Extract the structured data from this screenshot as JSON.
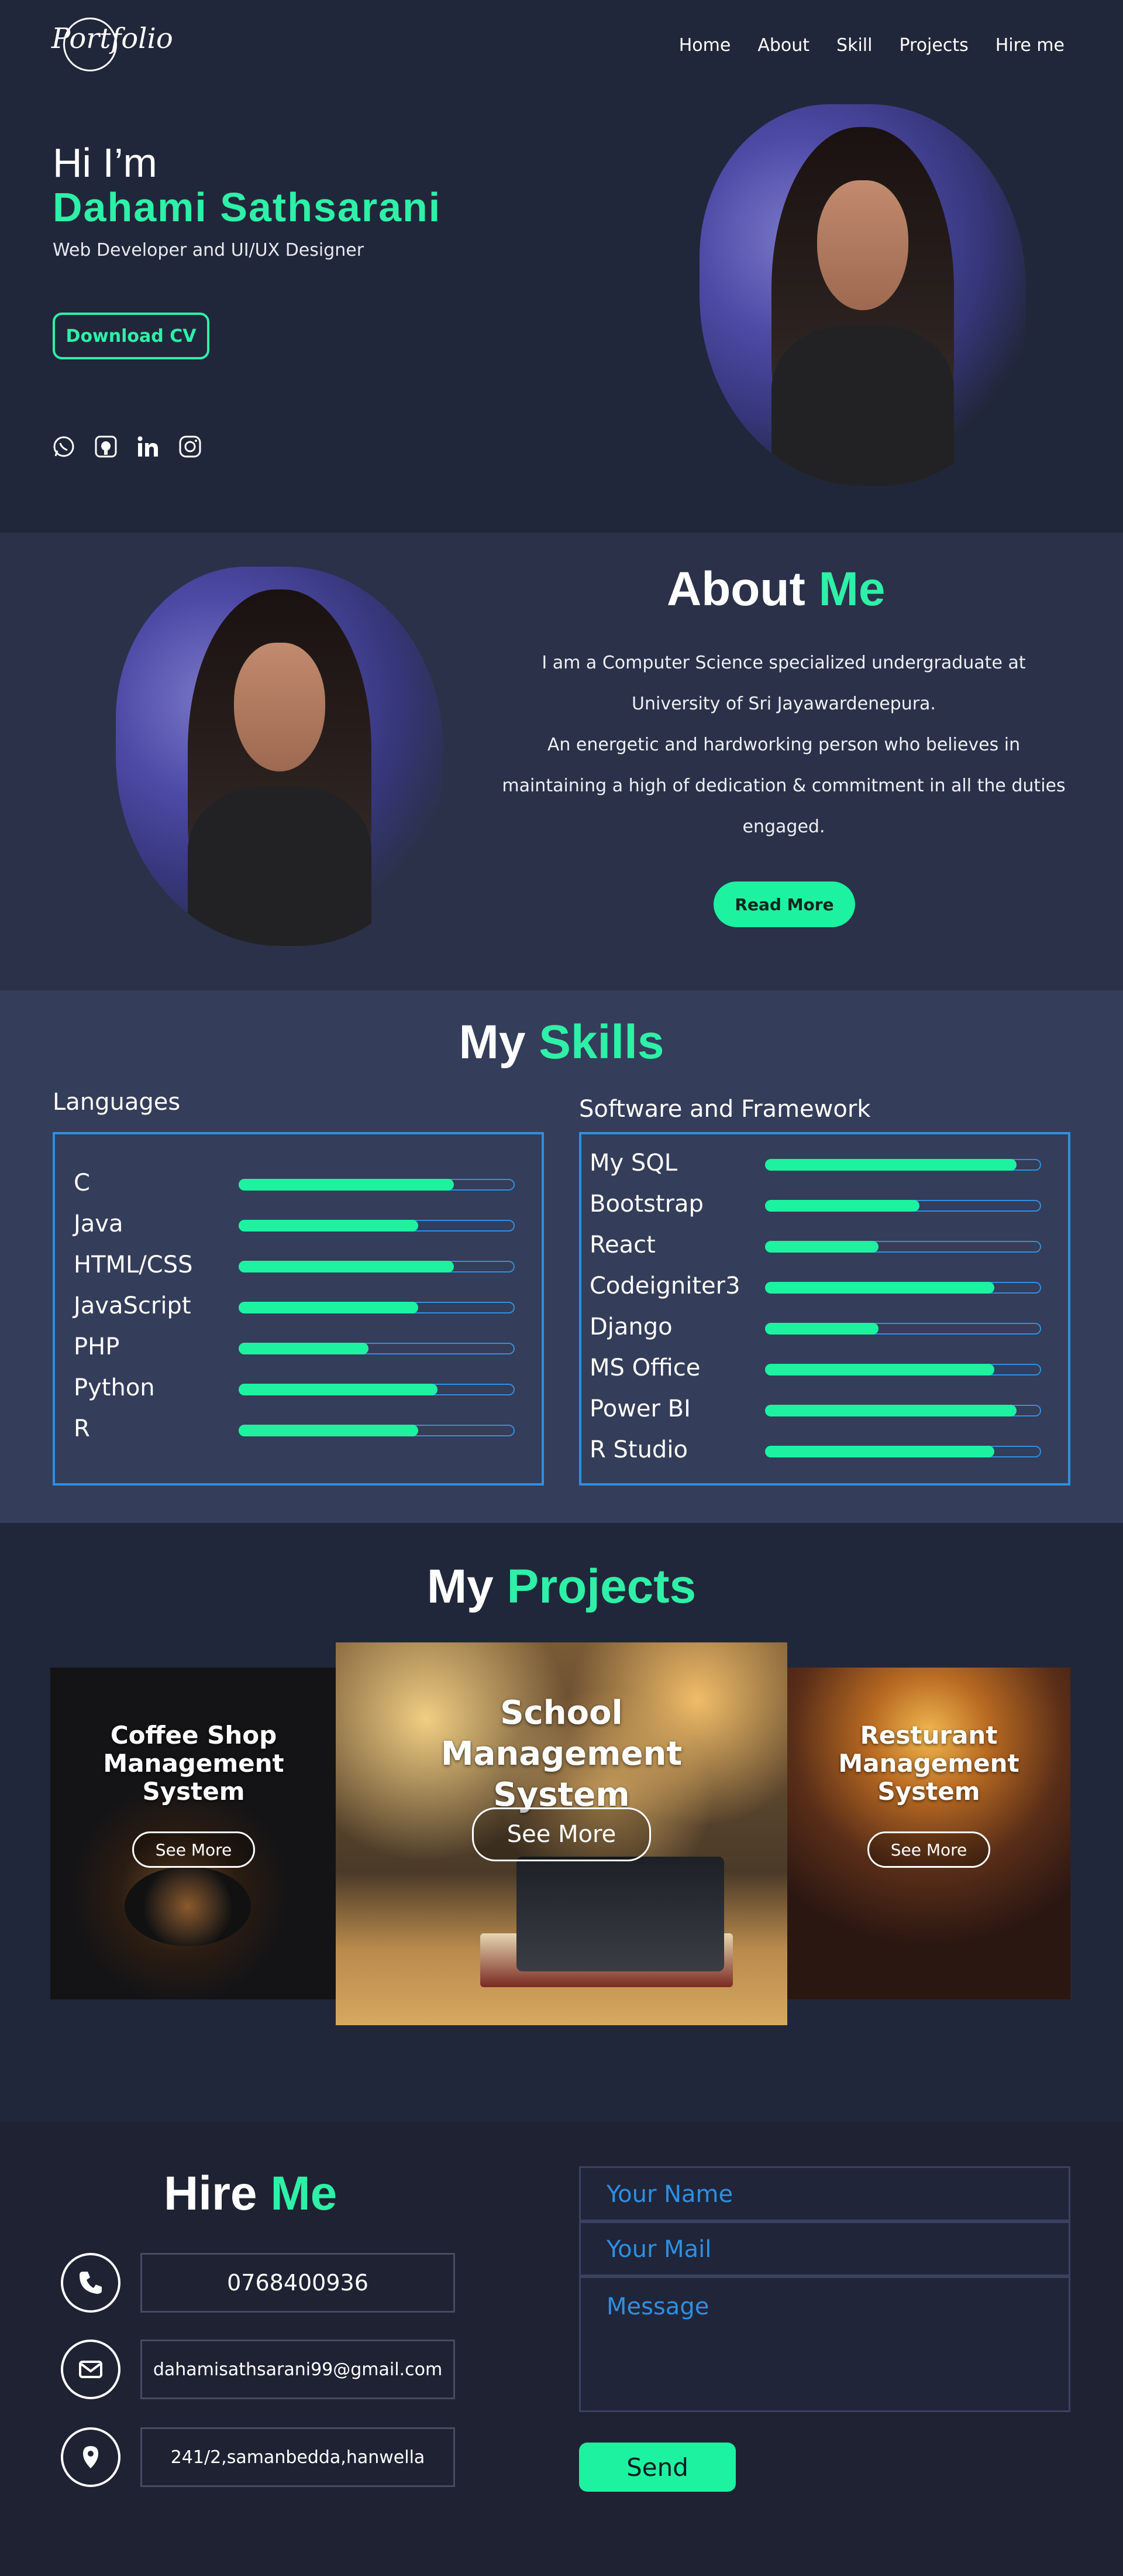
{
  "header": {
    "logo": "Portfolio",
    "nav": [
      "Home",
      "About",
      "Skill",
      "Projects",
      "Hire me"
    ]
  },
  "hero": {
    "greeting": "Hi I’m",
    "name": "Dahami Sathsarani",
    "role": "Web Developer and UI/UX Designer",
    "cv_button": "Download CV",
    "socials": [
      "whatsapp-icon",
      "github-icon",
      "linkedin-icon",
      "instagram-icon"
    ]
  },
  "about": {
    "title_main": "About",
    "title_accent": "Me",
    "lines": [
      "I am a Computer Science specialized undergraduate at",
      "University of Sri Jayawardenepura.",
      "An energetic and hardworking person who believes in",
      "maintaining a high of dedication & commitment in all the duties",
      "engaged."
    ],
    "button": "Read More"
  },
  "skills": {
    "title_main": "My",
    "title_accent": "Skills",
    "languages": {
      "heading": "Languages",
      "items": [
        {
          "label": "C",
          "level": 0.78
        },
        {
          "label": "Java",
          "level": 0.65
        },
        {
          "label": "HTML/CSS",
          "level": 0.78
        },
        {
          "label": "JavaScript",
          "level": 0.65
        },
        {
          "label": "PHP",
          "level": 0.47
        },
        {
          "label": "Python",
          "level": 0.72
        },
        {
          "label": "R",
          "level": 0.65
        }
      ]
    },
    "software": {
      "heading": "Software and Framework",
      "items": [
        {
          "label": "My SQL",
          "level": 0.91
        },
        {
          "label": "Bootstrap",
          "level": 0.56
        },
        {
          "label": "React",
          "level": 0.41
        },
        {
          "label": "Codeigniter3",
          "level": 0.83
        },
        {
          "label": "Django",
          "level": 0.41
        },
        {
          "label": "MS Office",
          "level": 0.83
        },
        {
          "label": "Power BI",
          "level": 0.91
        },
        {
          "label": "R Studio",
          "level": 0.83
        }
      ]
    }
  },
  "projects": {
    "title_main": "My",
    "title_accent": "Projects",
    "cards": [
      {
        "title": "Coffee Shop Management System",
        "button": "See More"
      },
      {
        "title": "School Management System",
        "button": "See More"
      },
      {
        "title": "Resturant Management System",
        "button": "See More"
      }
    ]
  },
  "hire": {
    "title_main": "Hire",
    "title_accent": "Me",
    "phone": "0768400936",
    "email": "dahamisathsarani99@gmail.com",
    "address": "241/2,samanbedda,hanwella",
    "form": {
      "name_placeholder": "Your Name",
      "mail_placeholder": "Your Mail",
      "message_placeholder": "Message",
      "send": "Send"
    }
  },
  "colors": {
    "accent": "#2ef0a7",
    "button": "#1df2a0",
    "border_blue": "#2f8fe0",
    "hero_bg": "#21273a",
    "about_bg": "#2a3149",
    "skills_bg": "#343d59"
  }
}
